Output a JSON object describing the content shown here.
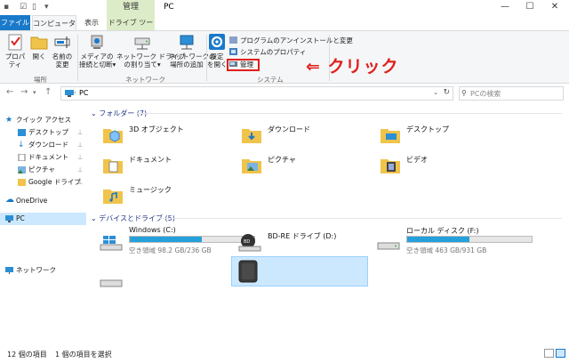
{
  "titlebar": {
    "context_tab": "管理",
    "title": "PC",
    "quick_access": [
      "▪",
      "☑",
      "▯",
      "▾"
    ],
    "window_buttons": [
      "—",
      "☐",
      "✕"
    ]
  },
  "tabs": {
    "file": "ファイル",
    "computer": "コンピューター",
    "view": "表示",
    "drive_tools": "ドライブ ツール"
  },
  "ribbon": {
    "location": {
      "properties": "プロパティ",
      "open": "開く",
      "rename": "名前の\n変更",
      "group_label": "場所"
    },
    "network": {
      "media_access": "メディアの\n接続と切断▾",
      "map_drive": "ネットワーク ドライブ\nの割り当て▾",
      "add_location": "ネットワークの\n場所の追加",
      "group_label": "ネットワーク"
    },
    "system": {
      "open_settings": "設定\nを開く",
      "uninstall": "プログラムのアンインストールと変更",
      "sys_props": "システムのプロパティ",
      "manage": "管理",
      "group_label": "システム"
    }
  },
  "annotation": {
    "text": "⇐ クリック",
    "color": "#e0201c"
  },
  "addressbar": {
    "path": "PC",
    "search_placeholder": "PCの検索"
  },
  "sidebar": {
    "items": [
      {
        "label": "クイック アクセス",
        "pinned": false
      },
      {
        "label": "デスクトップ",
        "pinned": true
      },
      {
        "label": "ダウンロード",
        "pinned": true
      },
      {
        "label": "ドキュメント",
        "pinned": true
      },
      {
        "label": "ピクチャ",
        "pinned": true
      },
      {
        "label": "Google ドライブ",
        "pinned": true
      },
      {
        "label": "OneDrive",
        "pinned": false
      },
      {
        "label": "PC",
        "pinned": false
      },
      {
        "label": "ネットワーク",
        "pinned": false
      }
    ],
    "pin_glyph": "📌"
  },
  "content": {
    "folders_header": "フォルダー (7)",
    "folders": [
      "3D オブジェクト",
      "ダウンロード",
      "デスクトップ",
      "ドキュメント",
      "ピクチャ",
      "ビデオ",
      "ミュージック"
    ],
    "drives_header": "デバイスとドライブ (5)",
    "drives": [
      {
        "name": "Windows (C:)",
        "free": "空き領域 98.2 GB/236 GB",
        "used_fraction": 0.58
      },
      {
        "name": "BD-RE ドライブ (D:)",
        "free": "",
        "used_fraction": null
      },
      {
        "name": "ローカル ディスク (F:)",
        "free": "空き領域 463 GB/931 GB",
        "used_fraction": 0.5
      }
    ]
  },
  "status": {
    "count": "12 個の項目",
    "selected": "1 個の項目を選択"
  },
  "colors": {
    "accent": "#1979ca",
    "context_tab": "#ddecc8",
    "selection": "#cce8ff",
    "drive_bar": "#26a0da",
    "folder": "#f0c34b"
  }
}
